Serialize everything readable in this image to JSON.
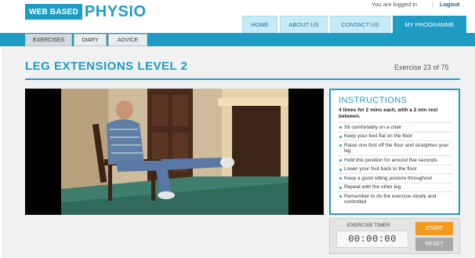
{
  "brand": {
    "box_text": "WEB BASED",
    "word_text": "PHYSIO",
    "accent_color": "#1f9cc3"
  },
  "user_bar": {
    "status": "You are logged in",
    "separator": "|",
    "logout_label": "Logout"
  },
  "main_nav": {
    "items": [
      {
        "label": "HOME"
      },
      {
        "label": "ABOUT US"
      },
      {
        "label": "CONTACT US"
      },
      {
        "label": "MY PROGRAMME"
      }
    ],
    "active": "MY PROGRAMME"
  },
  "sub_nav": {
    "items": [
      {
        "label": "EXERCISES"
      },
      {
        "label": "DIARY"
      },
      {
        "label": "ADVICE"
      }
    ],
    "active": "EXERCISES"
  },
  "exercise": {
    "title": "LEG EXTENSIONS LEVEL 2",
    "counter": "Exercise 23 of 75"
  },
  "video": {
    "description_icon": "video-frame"
  },
  "instructions": {
    "heading": "INSTRUCTIONS",
    "lead": "4 times for 2 mins each, with a 2 min rest between.",
    "steps": [
      "Sit comfortably on a chair",
      "Keep your feet flat on the floor",
      "Raise one foot off the floor and straighten your leg",
      "Hold this position for around five seconds",
      "Lower your foot back to the floor",
      "Keep a good sitting posture throughout",
      "Repeat with the other leg",
      "Remember to do the exercise slowly and controlled"
    ]
  },
  "timer": {
    "label": "EXERCISE TIMER",
    "value": "00:00:00",
    "start_label": "START",
    "reset_label": "RESET",
    "start_color": "#f39a1e",
    "reset_color": "#a8a8a8"
  }
}
